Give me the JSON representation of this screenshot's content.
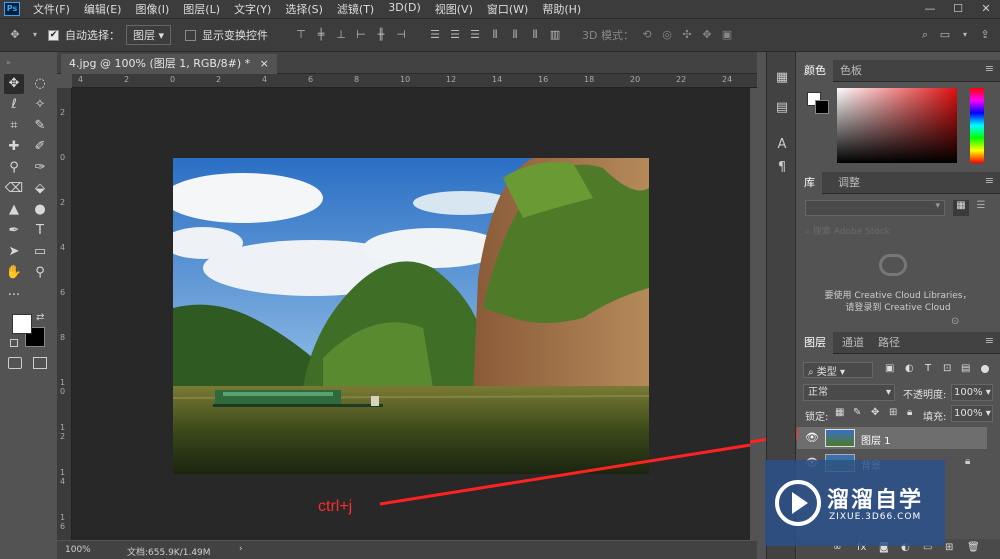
{
  "app": {
    "logo": "Ps"
  },
  "menu": [
    "文件(F)",
    "编辑(E)",
    "图像(I)",
    "图层(L)",
    "文字(Y)",
    "选择(S)",
    "滤镜(T)",
    "3D(D)",
    "视图(V)",
    "窗口(W)",
    "帮助(H)"
  ],
  "window_controls": {
    "minimize": "—",
    "maximize": "☐",
    "close": "✕"
  },
  "options": {
    "auto_select_label": "自动选择：",
    "auto_select_value": "图层",
    "show_transform_label": "显示变换控件",
    "mode_3d_label": "3D 模式："
  },
  "document": {
    "tab_title": "4.jpg @ 100% (图层 1, RGB/8#) *",
    "close": "×",
    "zoom": "100%",
    "doc_info": "文档:655.9K/1.49M"
  },
  "ruler": {
    "h_ticks": [
      "4",
      "2",
      "0",
      "2",
      "4",
      "6",
      "8",
      "10",
      "12",
      "14",
      "16",
      "18",
      "20",
      "22",
      "24"
    ],
    "v_ticks": [
      "2",
      "0",
      "2",
      "4",
      "6",
      "8",
      "1 0",
      "1 2",
      "1 4",
      "1 6"
    ]
  },
  "annotation": {
    "text": "ctrl+j",
    "color": "#ff2a2a"
  },
  "color_panel": {
    "tabs": [
      "颜色",
      "色板"
    ]
  },
  "library_panel": {
    "tabs": [
      "库",
      "调整"
    ],
    "search_placeholder": "搜索 Adobe Stock",
    "message_line1": "要使用 Creative Cloud Libraries，",
    "message_line2": "请登录到 Creative Cloud"
  },
  "layers_panel": {
    "tabs": [
      "图层",
      "通道",
      "路径"
    ],
    "filter_label": "类型",
    "blend_mode": "正常",
    "opacity_label": "不透明度:",
    "opacity_value": "100%",
    "lock_label": "锁定:",
    "fill_label": "填充:",
    "fill_value": "100%",
    "layers": [
      {
        "name": "图层 1",
        "visible": true,
        "selected": true
      },
      {
        "name": "背景",
        "visible": true,
        "selected": false,
        "locked": true
      }
    ]
  },
  "watermark": {
    "title": "溜溜自学",
    "url": "ZIXUE.3D66.COM"
  },
  "colors": {
    "accent": "#31a8ff",
    "foreground": "#ffffff",
    "background": "#000000"
  }
}
